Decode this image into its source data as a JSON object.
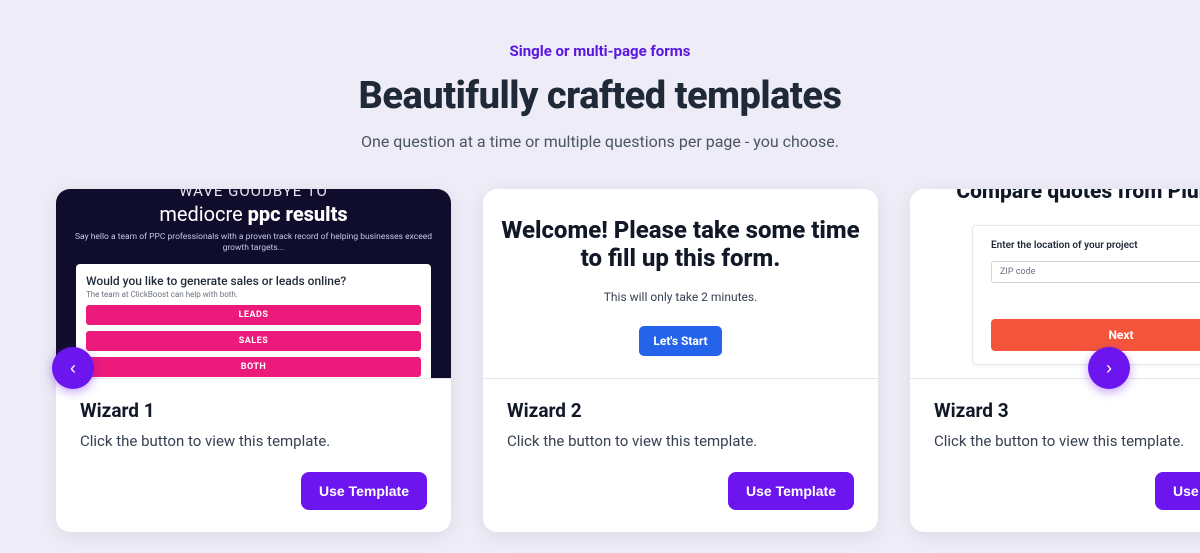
{
  "header": {
    "eyebrow": "Single or multi-page forms",
    "title": "Beautifully crafted templates",
    "subtitle": "One question at a time or multiple questions per page - you choose."
  },
  "cards": [
    {
      "title": "Wizard 1",
      "desc": "Click the button to view this template.",
      "cta": "Use Template",
      "preview": {
        "line1": "Wave GOODBYE TO",
        "line2_a": "mediocre ",
        "line2_b": "ppc results",
        "sub": "Say hello a team of PPC professionals with a proven track record of helping businesses exceed growth targets...",
        "question": "Would you like to generate sales or leads online?",
        "question_sub": "The team at ClickBoost can help with both.",
        "options": [
          "LEADS",
          "SALES",
          "BOTH"
        ]
      }
    },
    {
      "title": "Wizard 2",
      "desc": "Click the button to view this template.",
      "cta": "Use Template",
      "preview": {
        "big": "Welcome! Please take some time to fill up this form.",
        "sm": "This will only take 2 minutes.",
        "start": "Let's Start"
      }
    },
    {
      "title": "Wizard 3",
      "desc": "Click the button to view this template.",
      "cta": "Use Template",
      "preview": {
        "hdr": "Compare quotes from Plumbers",
        "lbl": "Enter the location of your project",
        "placeholder": "ZIP code",
        "next": "Next"
      }
    }
  ],
  "nav": {
    "prev": "‹",
    "next": "›"
  }
}
